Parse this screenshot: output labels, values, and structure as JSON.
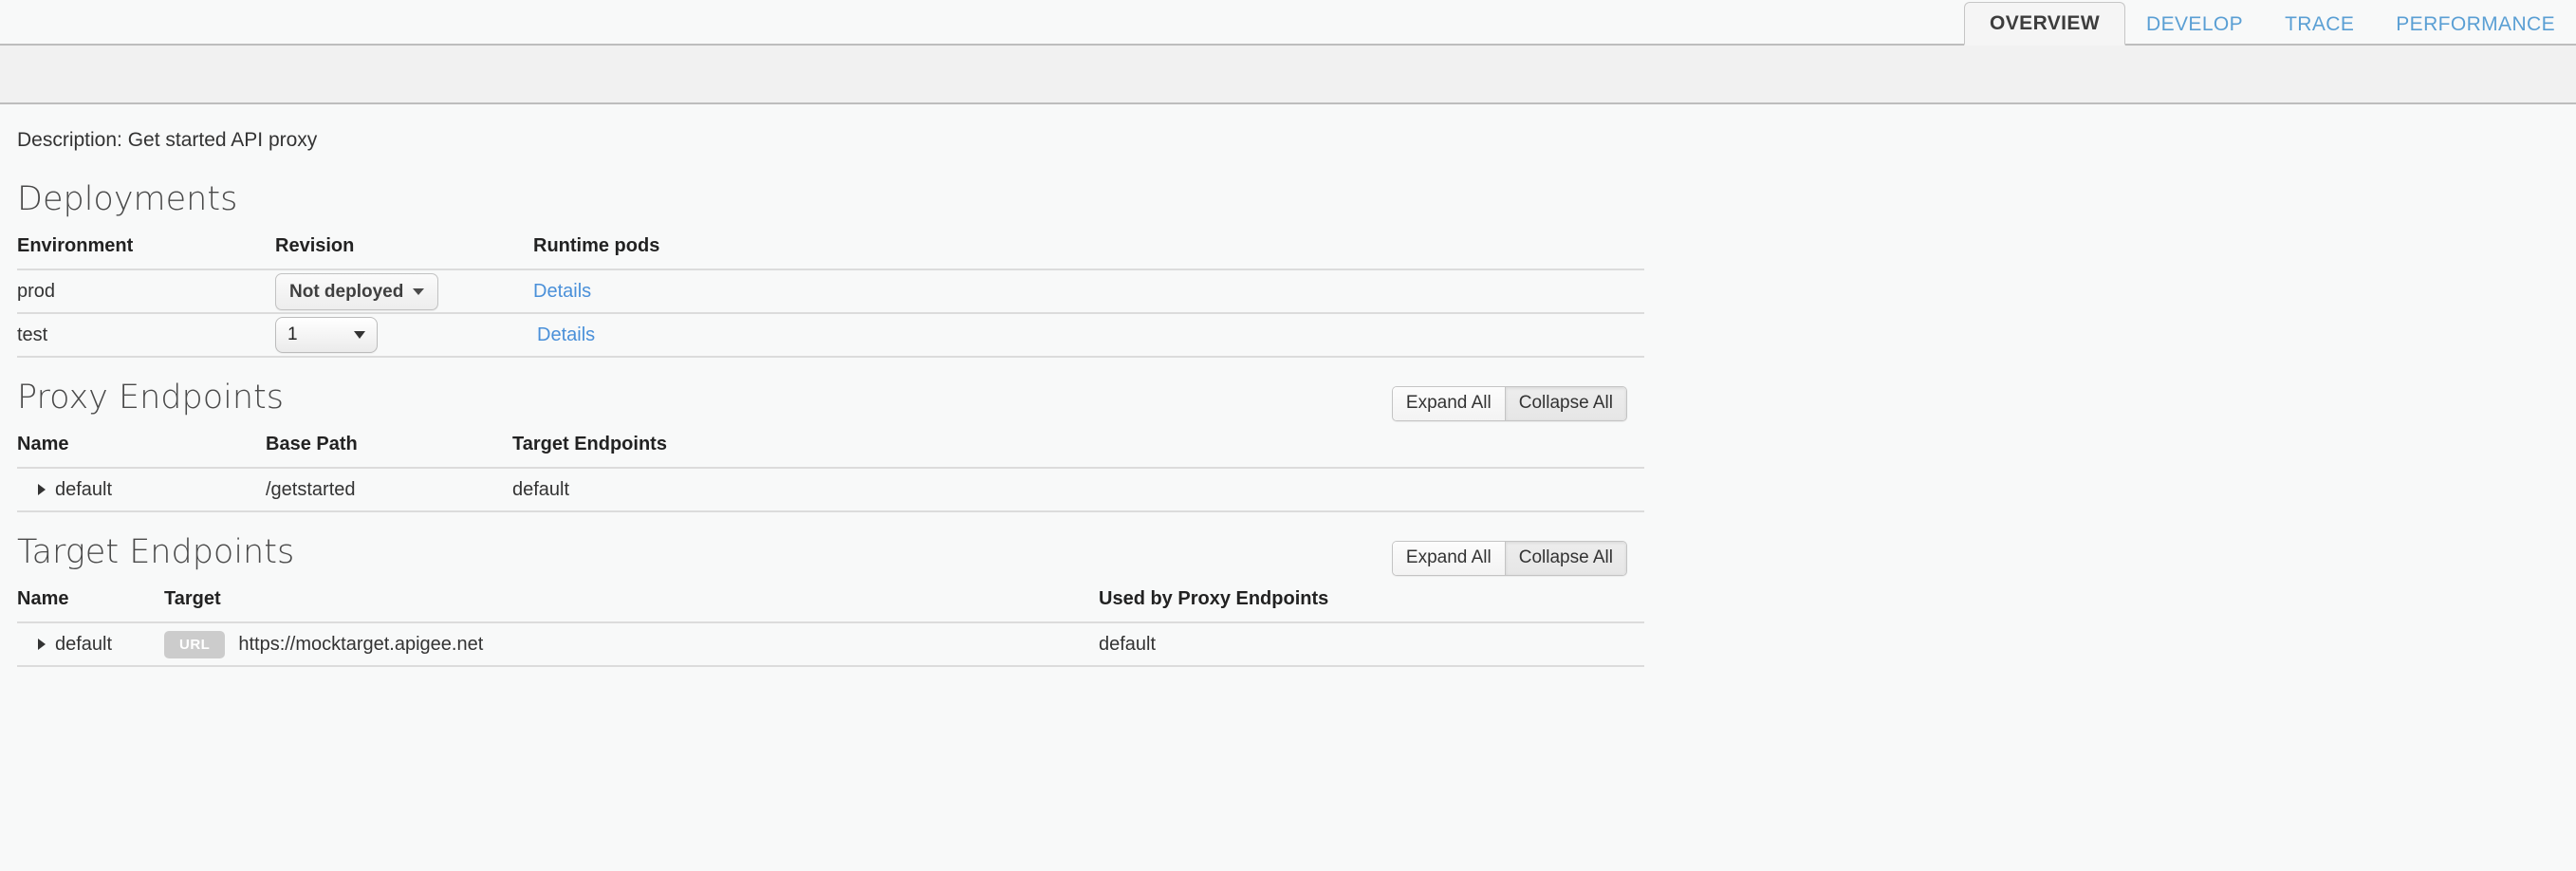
{
  "tabs": [
    {
      "label": "OVERVIEW",
      "active": true
    },
    {
      "label": "DEVELOP",
      "active": false
    },
    {
      "label": "TRACE",
      "active": false
    },
    {
      "label": "PERFORMANCE",
      "active": false
    }
  ],
  "description": "Description: Get started API proxy",
  "colors": {
    "link": "#4a90d9",
    "tab_inactive": "#5a9fd4",
    "tab_active_text": "#3d3d3d",
    "badge_bg": "#cccccc",
    "page_bg": "#f8f9f9",
    "band_bg": "#f1f1f1",
    "rule": "#dcdcdc"
  },
  "deployments": {
    "title": "Deployments",
    "columns": [
      "Environment",
      "Revision",
      "Runtime pods"
    ],
    "rows": [
      {
        "environment": "prod",
        "revision_control": "button",
        "revision_value": "Not deployed",
        "runtime_pods_link": "Details"
      },
      {
        "environment": "test",
        "revision_control": "select",
        "revision_value": "1",
        "runtime_pods_link": "Details"
      }
    ]
  },
  "proxy_endpoints": {
    "title": "Proxy Endpoints",
    "expand_all": "Expand All",
    "collapse_all": "Collapse All",
    "columns": [
      "Name",
      "Base Path",
      "Target Endpoints"
    ],
    "rows": [
      {
        "name": "default",
        "base_path": "/getstarted",
        "target_endpoints": "default"
      }
    ]
  },
  "target_endpoints": {
    "title": "Target Endpoints",
    "expand_all": "Expand All",
    "collapse_all": "Collapse All",
    "columns": [
      "Name",
      "Target",
      "Used by Proxy Endpoints"
    ],
    "rows": [
      {
        "name": "default",
        "target_badge": "URL",
        "target": "https://mocktarget.apigee.net",
        "used_by": "default"
      }
    ]
  }
}
